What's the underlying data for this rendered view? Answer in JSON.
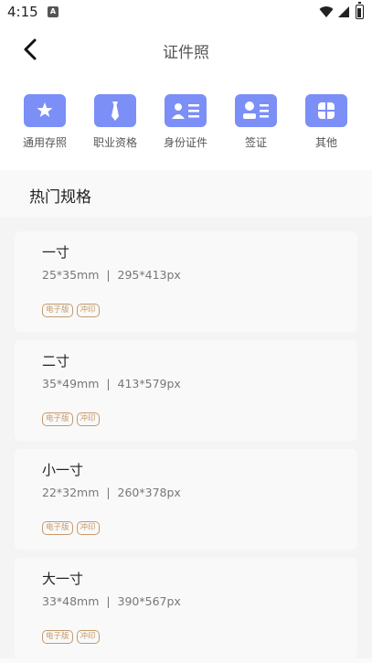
{
  "status": {
    "time": "4:15",
    "notif_badge": "A"
  },
  "header": {
    "title": "证件照"
  },
  "categories": [
    {
      "label": "通用存照",
      "icon": "star-icon"
    },
    {
      "label": "职业资格",
      "icon": "tie-icon"
    },
    {
      "label": "身份证件",
      "icon": "id-card-icon"
    },
    {
      "label": "签证",
      "icon": "visa-icon"
    },
    {
      "label": "其他",
      "icon": "more-grid-icon"
    }
  ],
  "section": {
    "title": "热门规格"
  },
  "items": [
    {
      "name": "一寸",
      "spec": "25*35mm  |  295*413px",
      "tags": [
        "电子版",
        "冲印"
      ]
    },
    {
      "name": "二寸",
      "spec": "35*49mm  |  413*579px",
      "tags": [
        "电子版",
        "冲印"
      ]
    },
    {
      "name": "小一寸",
      "spec": "22*32mm  |  260*378px",
      "tags": [
        "电子版",
        "冲印"
      ]
    },
    {
      "name": "大一寸",
      "spec": "33*48mm  |  390*567px",
      "tags": [
        "电子版",
        "冲印"
      ]
    }
  ],
  "colors": {
    "accent": "#7b8ff7",
    "tag": "#c49a6c"
  }
}
